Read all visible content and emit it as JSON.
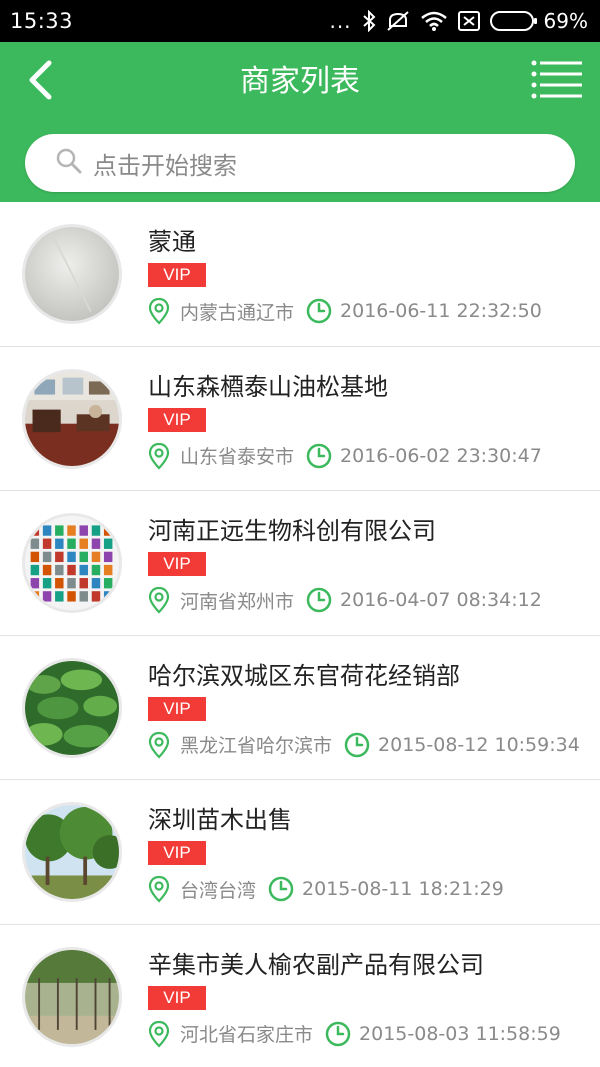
{
  "status_bar": {
    "time": "15:33",
    "dots": "...",
    "battery_text": "69%",
    "battery_level": 0.69
  },
  "header": {
    "title": "商家列表",
    "back_icon": "chevron-left-icon",
    "menu_icon": "list-menu-icon",
    "color": "#3cb95c"
  },
  "search": {
    "placeholder": "点击开始搜索",
    "icon": "search-icon"
  },
  "merchants": [
    {
      "name": "蒙通",
      "badge": "VIP",
      "location": "内蒙古通辽市",
      "time": "2016-06-11 22:32:50",
      "avatar": "tile-floor"
    },
    {
      "name": "山东森槱泰山油松基地",
      "badge": "VIP",
      "location": "山东省泰安市",
      "time": "2016-06-02 23:30:47",
      "avatar": "office"
    },
    {
      "name": "河南正远生物科创有限公司",
      "badge": "VIP",
      "location": "河南省郑州市",
      "time": "2016-04-07 08:34:12",
      "avatar": "product-grid"
    },
    {
      "name": "哈尔滨双城区东官荷花经销部",
      "badge": "VIP",
      "location": "黑龙江省哈尔滨市",
      "time": "2015-08-12 10:59:34",
      "avatar": "lotus-leaves"
    },
    {
      "name": "深圳苗木出售",
      "badge": "VIP",
      "location": "台湾台湾",
      "time": "2015-08-11 18:21:29",
      "avatar": "trees"
    },
    {
      "name": "辛集市美人榆农副产品有限公司",
      "badge": "VIP",
      "location": "河北省石家庄市",
      "time": "2015-08-03 11:58:59",
      "avatar": "nursery"
    }
  ],
  "colors": {
    "accent": "#3cb95c",
    "vip": "#f23b36",
    "meta_text": "#8a8a8a"
  }
}
